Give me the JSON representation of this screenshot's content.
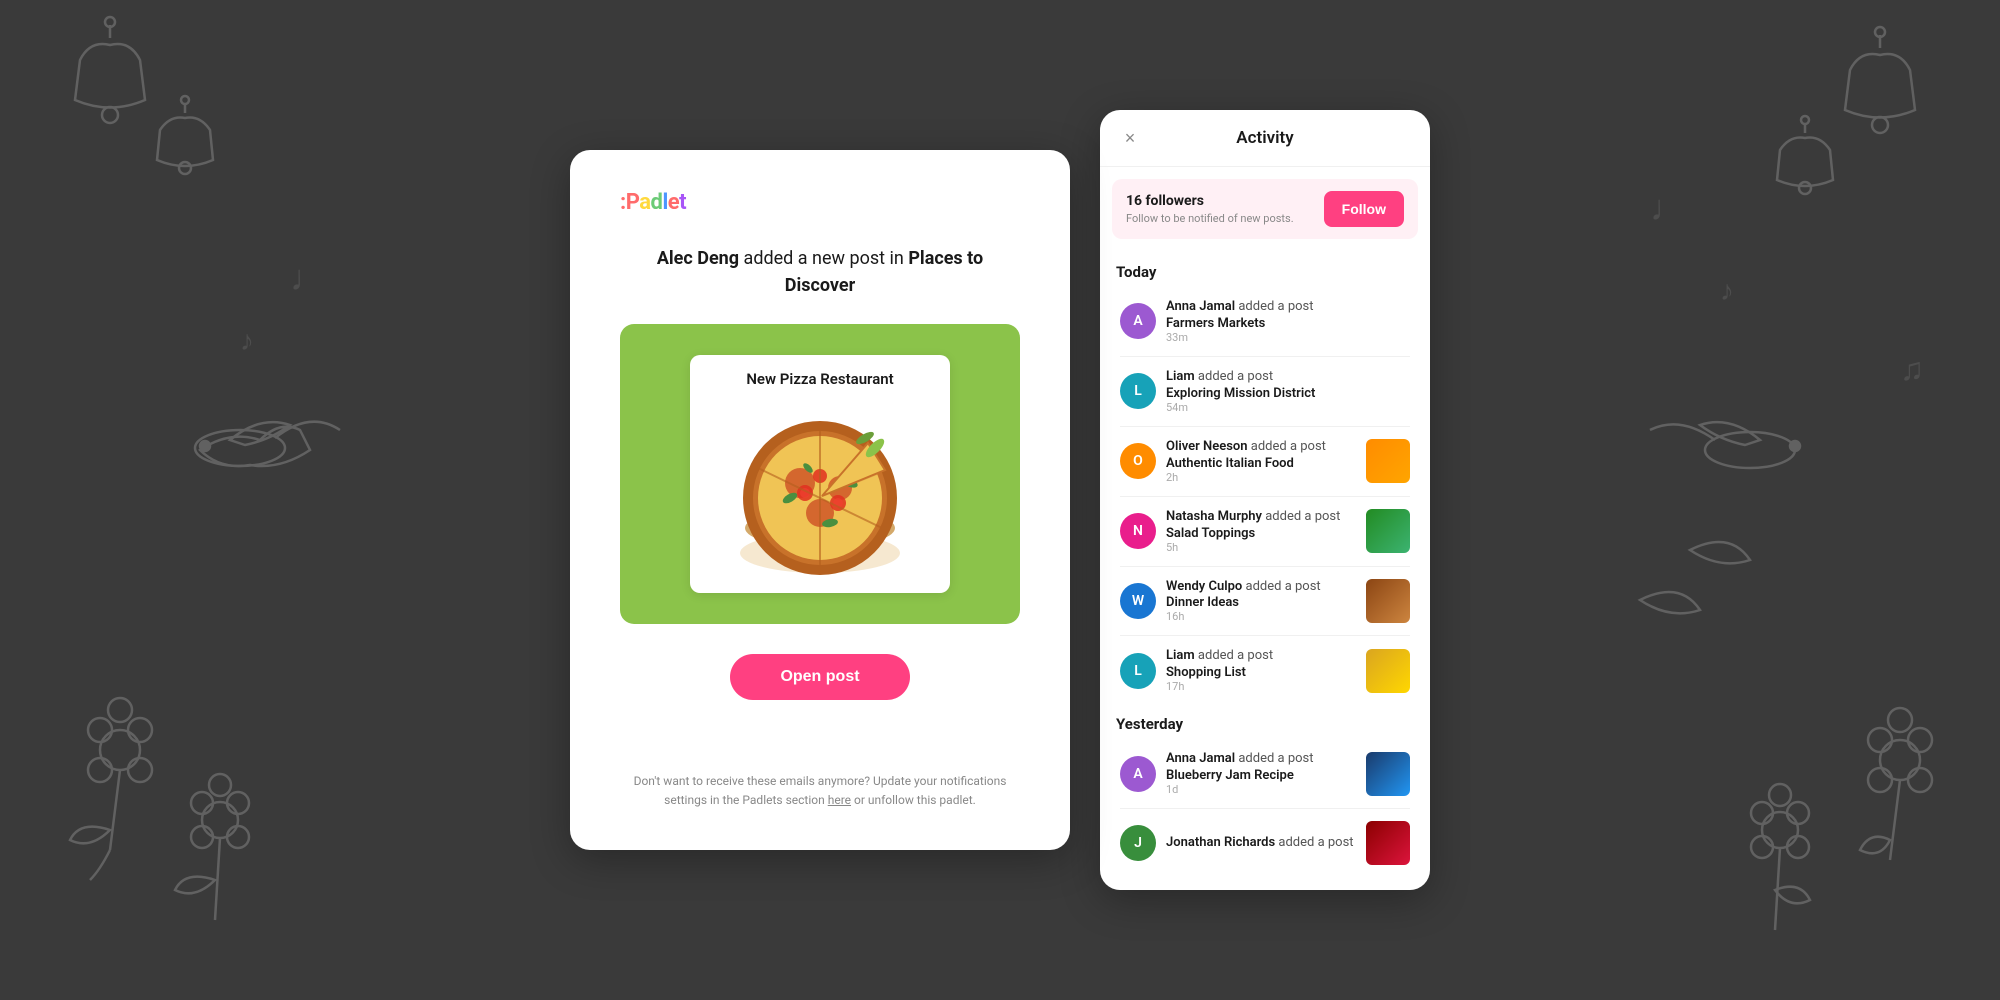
{
  "background": {
    "color": "#3a3a3a"
  },
  "email_card": {
    "logo": ":Padlet",
    "title_pre": " added a new post in ",
    "author": "Alec Deng",
    "board": "Places to Discover",
    "post_card": {
      "title": "New Pizza Restaurant"
    },
    "open_post_label": "Open post",
    "footer_text": "Don't want to receive these emails anymore? Update your notifications settings in the Padlets section ",
    "footer_link": "here",
    "footer_suffix": " or unfollow this padlet."
  },
  "activity_panel": {
    "title": "Activity",
    "close_icon": "×",
    "followers": {
      "count": "16 followers",
      "subtitle": "Follow to be notified of new posts.",
      "follow_label": "Follow"
    },
    "today_label": "Today",
    "yesterday_label": "Yesterday",
    "today_items": [
      {
        "user": "Anna Jamal",
        "action": "added a post",
        "post": "Farmers Markets",
        "time": "33m",
        "avatar_letter": "A",
        "avatar_class": "av-purple",
        "has_thumb": false
      },
      {
        "user": "Liam",
        "action": "added a post",
        "post": "Exploring Mission District",
        "time": "54m",
        "avatar_letter": "L",
        "avatar_class": "av-teal",
        "has_thumb": false
      },
      {
        "user": "Oliver Neeson",
        "action": "added a post",
        "post": "Authentic Italian Food",
        "time": "2h",
        "avatar_letter": "O",
        "avatar_class": "av-orange",
        "has_thumb": true,
        "thumb_class": "thumb-orange"
      },
      {
        "user": "Natasha Murphy",
        "action": "added a post",
        "post": "Salad Toppings",
        "time": "5h",
        "avatar_letter": "N",
        "avatar_class": "av-pink",
        "has_thumb": true,
        "thumb_class": "thumb-green"
      },
      {
        "user": "Wendy Culpo",
        "action": "added a post",
        "post": "Dinner Ideas",
        "time": "16h",
        "avatar_letter": "W",
        "avatar_class": "av-blue",
        "has_thumb": true,
        "thumb_class": "thumb-warm"
      },
      {
        "user": "Liam",
        "action": "added a post",
        "post": "Shopping List",
        "time": "17h",
        "avatar_letter": "L",
        "avatar_class": "av-teal",
        "has_thumb": true,
        "thumb_class": "thumb-yellow"
      }
    ],
    "yesterday_items": [
      {
        "user": "Anna Jamal",
        "action": "added a post",
        "post": "Blueberry Jam Recipe",
        "time": "1d",
        "avatar_letter": "A",
        "avatar_class": "av-purple",
        "has_thumb": true,
        "thumb_class": "thumb-blue"
      },
      {
        "user": "Jonathan Richards",
        "action": "added a post",
        "post": "",
        "time": "",
        "avatar_letter": "J",
        "avatar_class": "av-green",
        "has_thumb": true,
        "thumb_class": "thumb-red"
      }
    ]
  }
}
